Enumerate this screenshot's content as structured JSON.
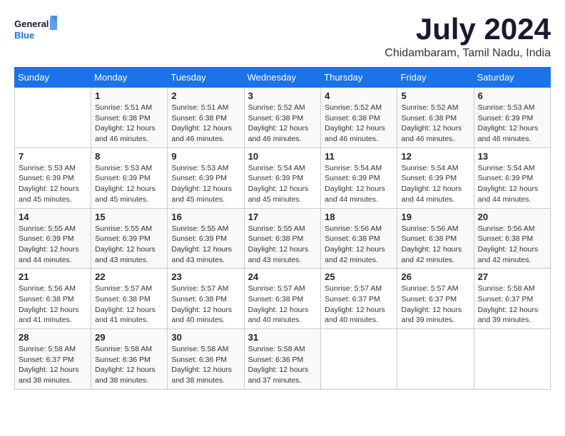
{
  "header": {
    "logo_line1": "General",
    "logo_line2": "Blue",
    "month": "July 2024",
    "location": "Chidambaram, Tamil Nadu, India"
  },
  "days_of_week": [
    "Sunday",
    "Monday",
    "Tuesday",
    "Wednesday",
    "Thursday",
    "Friday",
    "Saturday"
  ],
  "weeks": [
    [
      {
        "day": "",
        "info": ""
      },
      {
        "day": "1",
        "info": "Sunrise: 5:51 AM\nSunset: 6:38 PM\nDaylight: 12 hours\nand 46 minutes."
      },
      {
        "day": "2",
        "info": "Sunrise: 5:51 AM\nSunset: 6:38 PM\nDaylight: 12 hours\nand 46 minutes."
      },
      {
        "day": "3",
        "info": "Sunrise: 5:52 AM\nSunset: 6:38 PM\nDaylight: 12 hours\nand 46 minutes."
      },
      {
        "day": "4",
        "info": "Sunrise: 5:52 AM\nSunset: 6:38 PM\nDaylight: 12 hours\nand 46 minutes."
      },
      {
        "day": "5",
        "info": "Sunrise: 5:52 AM\nSunset: 6:38 PM\nDaylight: 12 hours\nand 46 minutes."
      },
      {
        "day": "6",
        "info": "Sunrise: 5:53 AM\nSunset: 6:39 PM\nDaylight: 12 hours\nand 46 minutes."
      }
    ],
    [
      {
        "day": "7",
        "info": "Sunrise: 5:53 AM\nSunset: 6:39 PM\nDaylight: 12 hours\nand 45 minutes."
      },
      {
        "day": "8",
        "info": "Sunrise: 5:53 AM\nSunset: 6:39 PM\nDaylight: 12 hours\nand 45 minutes."
      },
      {
        "day": "9",
        "info": "Sunrise: 5:53 AM\nSunset: 6:39 PM\nDaylight: 12 hours\nand 45 minutes."
      },
      {
        "day": "10",
        "info": "Sunrise: 5:54 AM\nSunset: 6:39 PM\nDaylight: 12 hours\nand 45 minutes."
      },
      {
        "day": "11",
        "info": "Sunrise: 5:54 AM\nSunset: 6:39 PM\nDaylight: 12 hours\nand 44 minutes."
      },
      {
        "day": "12",
        "info": "Sunrise: 5:54 AM\nSunset: 6:39 PM\nDaylight: 12 hours\nand 44 minutes."
      },
      {
        "day": "13",
        "info": "Sunrise: 5:54 AM\nSunset: 6:39 PM\nDaylight: 12 hours\nand 44 minutes."
      }
    ],
    [
      {
        "day": "14",
        "info": "Sunrise: 5:55 AM\nSunset: 6:39 PM\nDaylight: 12 hours\nand 44 minutes."
      },
      {
        "day": "15",
        "info": "Sunrise: 5:55 AM\nSunset: 6:39 PM\nDaylight: 12 hours\nand 43 minutes."
      },
      {
        "day": "16",
        "info": "Sunrise: 5:55 AM\nSunset: 6:39 PM\nDaylight: 12 hours\nand 43 minutes."
      },
      {
        "day": "17",
        "info": "Sunrise: 5:55 AM\nSunset: 6:38 PM\nDaylight: 12 hours\nand 43 minutes."
      },
      {
        "day": "18",
        "info": "Sunrise: 5:56 AM\nSunset: 6:38 PM\nDaylight: 12 hours\nand 42 minutes."
      },
      {
        "day": "19",
        "info": "Sunrise: 5:56 AM\nSunset: 6:38 PM\nDaylight: 12 hours\nand 42 minutes."
      },
      {
        "day": "20",
        "info": "Sunrise: 5:56 AM\nSunset: 6:38 PM\nDaylight: 12 hours\nand 42 minutes."
      }
    ],
    [
      {
        "day": "21",
        "info": "Sunrise: 5:56 AM\nSunset: 6:38 PM\nDaylight: 12 hours\nand 41 minutes."
      },
      {
        "day": "22",
        "info": "Sunrise: 5:57 AM\nSunset: 6:38 PM\nDaylight: 12 hours\nand 41 minutes."
      },
      {
        "day": "23",
        "info": "Sunrise: 5:57 AM\nSunset: 6:38 PM\nDaylight: 12 hours\nand 40 minutes."
      },
      {
        "day": "24",
        "info": "Sunrise: 5:57 AM\nSunset: 6:38 PM\nDaylight: 12 hours\nand 40 minutes."
      },
      {
        "day": "25",
        "info": "Sunrise: 5:57 AM\nSunset: 6:37 PM\nDaylight: 12 hours\nand 40 minutes."
      },
      {
        "day": "26",
        "info": "Sunrise: 5:57 AM\nSunset: 6:37 PM\nDaylight: 12 hours\nand 39 minutes."
      },
      {
        "day": "27",
        "info": "Sunrise: 5:58 AM\nSunset: 6:37 PM\nDaylight: 12 hours\nand 39 minutes."
      }
    ],
    [
      {
        "day": "28",
        "info": "Sunrise: 5:58 AM\nSunset: 6:37 PM\nDaylight: 12 hours\nand 38 minutes."
      },
      {
        "day": "29",
        "info": "Sunrise: 5:58 AM\nSunset: 6:36 PM\nDaylight: 12 hours\nand 38 minutes."
      },
      {
        "day": "30",
        "info": "Sunrise: 5:58 AM\nSunset: 6:36 PM\nDaylight: 12 hours\nand 38 minutes."
      },
      {
        "day": "31",
        "info": "Sunrise: 5:58 AM\nSunset: 6:36 PM\nDaylight: 12 hours\nand 37 minutes."
      },
      {
        "day": "",
        "info": ""
      },
      {
        "day": "",
        "info": ""
      },
      {
        "day": "",
        "info": ""
      }
    ]
  ]
}
